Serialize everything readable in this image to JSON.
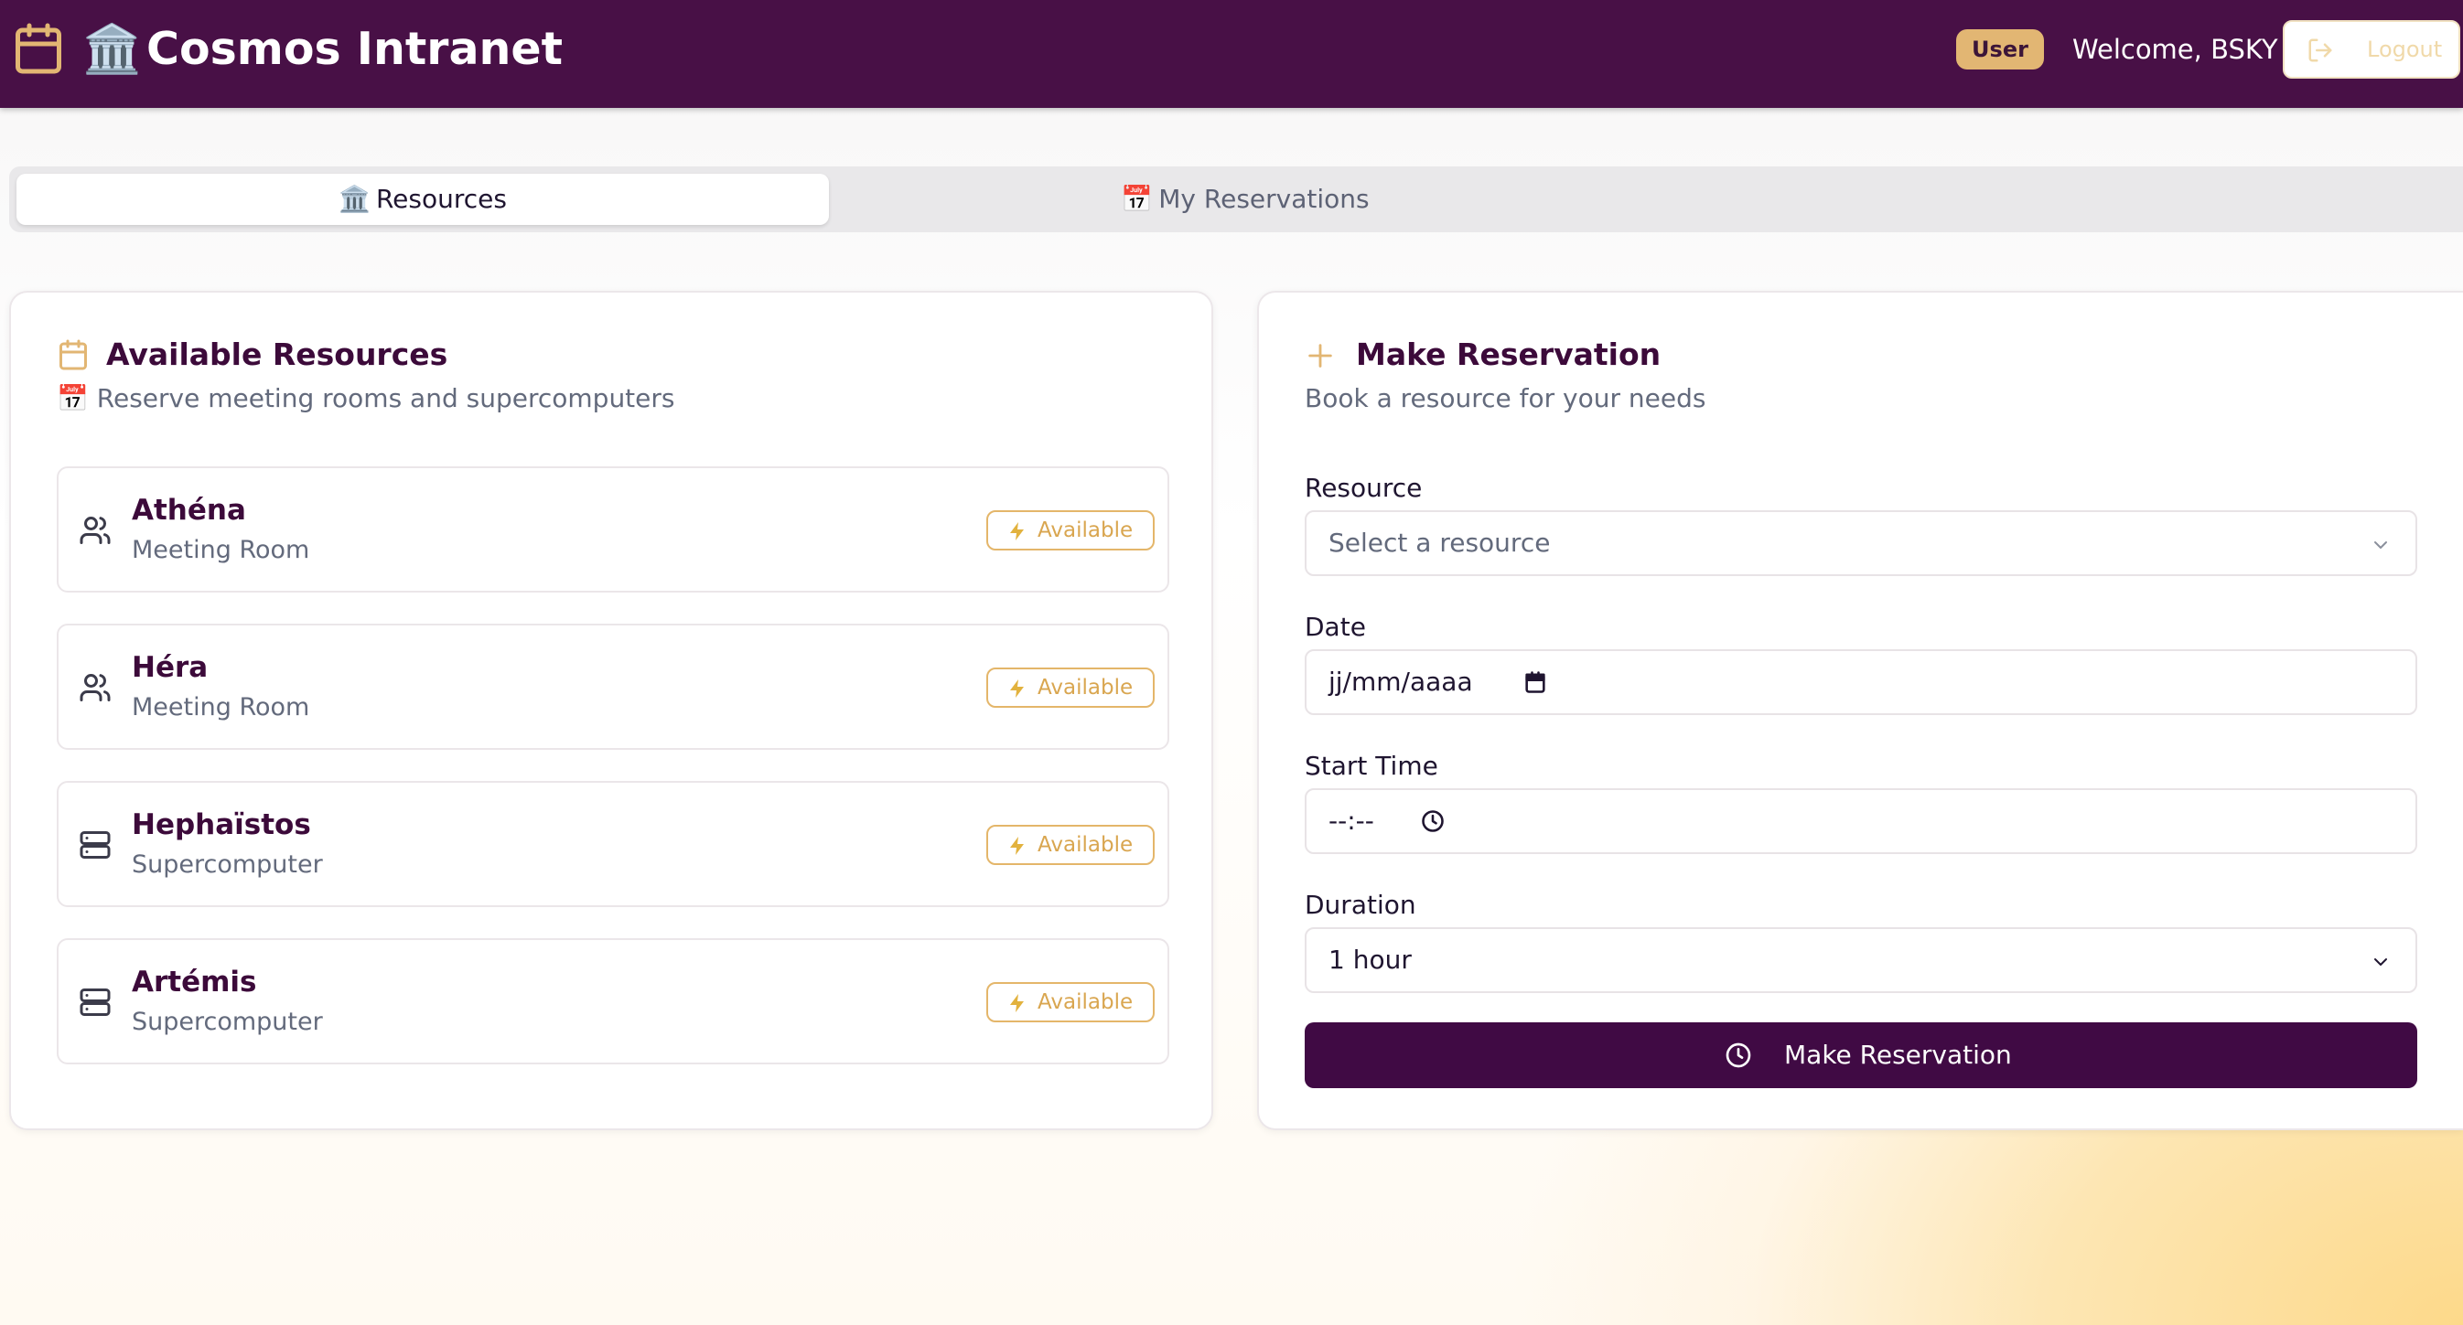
{
  "header": {
    "app_title": "Cosmos Intranet",
    "title_emoji": "🏛️",
    "role_badge": "User",
    "welcome": "Welcome, BSKY",
    "logout_label": "Logout",
    "background": "#481046"
  },
  "tabs": [
    {
      "emoji": "🏛️",
      "label": "Resources",
      "active": true
    },
    {
      "emoji": "📅",
      "label": "My Reservations",
      "active": false
    }
  ],
  "resources_panel": {
    "title": "Available Resources",
    "subtitle_emoji": "📅",
    "subtitle": "Reserve meeting rooms and supercomputers",
    "items": [
      {
        "name": "Athéna",
        "type": "Meeting Room",
        "icon": "users-icon",
        "status": "Available"
      },
      {
        "name": "Héra",
        "type": "Meeting Room",
        "icon": "users-icon",
        "status": "Available"
      },
      {
        "name": "Hephaïstos",
        "type": "Supercomputer",
        "icon": "server-icon",
        "status": "Available"
      },
      {
        "name": "Artémis",
        "type": "Supercomputer",
        "icon": "server-icon",
        "status": "Available"
      }
    ]
  },
  "reservation_form": {
    "title": "Make Reservation",
    "subtitle": "Book a resource for your needs",
    "resource": {
      "label": "Resource",
      "placeholder": "Select a resource"
    },
    "date": {
      "label": "Date",
      "placeholder": "jj/mm/aaaa"
    },
    "start_time": {
      "label": "Start Time",
      "placeholder": "--:--"
    },
    "duration": {
      "label": "Duration",
      "value": "1 hour"
    },
    "submit_label": "Make Reservation"
  },
  "colors": {
    "brand": "#481046",
    "accent": "#e2b673",
    "button": "#400a44"
  }
}
